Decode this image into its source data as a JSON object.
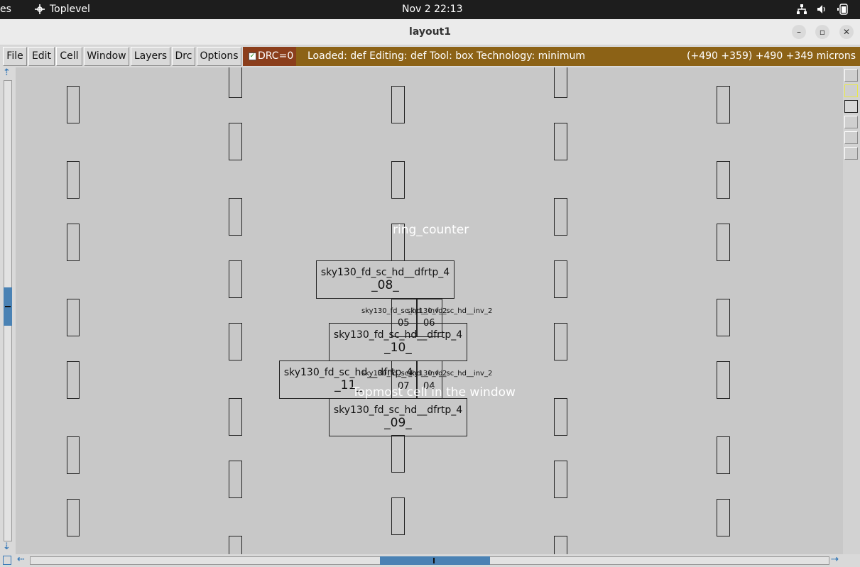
{
  "topbar": {
    "left_fragment": "es",
    "app_name": "Toplevel",
    "clock": "Nov 2  22:13"
  },
  "window": {
    "title": "layout1"
  },
  "menu": [
    "File",
    "Edit",
    "Cell",
    "Window",
    "Layers",
    "Drc",
    "Options"
  ],
  "drc": {
    "label": "DRC=0",
    "checked": true
  },
  "status": {
    "text": "Loaded: def Editing: def Tool: box  Technology: minimum",
    "coords": "(+490 +359) +490 +349 microns"
  },
  "labels": {
    "top_cell": "ring_counter",
    "topmost_hint": "Topmost cell in the window"
  },
  "cells": [
    {
      "name": "sky130_fd_sc_hd__dfrtp_4",
      "inst": "_08_"
    },
    {
      "name": "sky130_fd_sc_hd__dfrtp_4",
      "inst": "_10_"
    },
    {
      "name": "sky130_fd_sc_hd__dfrtp_4",
      "inst": "_11_"
    },
    {
      "name": "sky130_fd_sc_hd__dfrtp_4",
      "inst": "_09_"
    }
  ],
  "small_cells": {
    "row1_label_a": "sky130_fd_sc_hd__inv_2",
    "row1_label_b": "sky130_fd_sc_hd__inv_2",
    "row1_id_a": "05",
    "row1_id_b": "06",
    "row2_label_a": "sky130_fd_sc_hd__inv_2",
    "row2_label_b": "sky130_fd_sc_hd__inv_2",
    "row2_id_a": "07",
    "row2_id_b": "04"
  },
  "colors": {
    "drc_bg": "#8b3e1c",
    "status_bg": "#8c6216",
    "canvas_bg": "#c8c8c8",
    "scroll_accent": "#4a82b4"
  },
  "icons": [
    "toplevel-icon",
    "network-icon",
    "volume-icon",
    "battery-icon",
    "minimize-icon",
    "maximize-icon",
    "close-icon"
  ]
}
